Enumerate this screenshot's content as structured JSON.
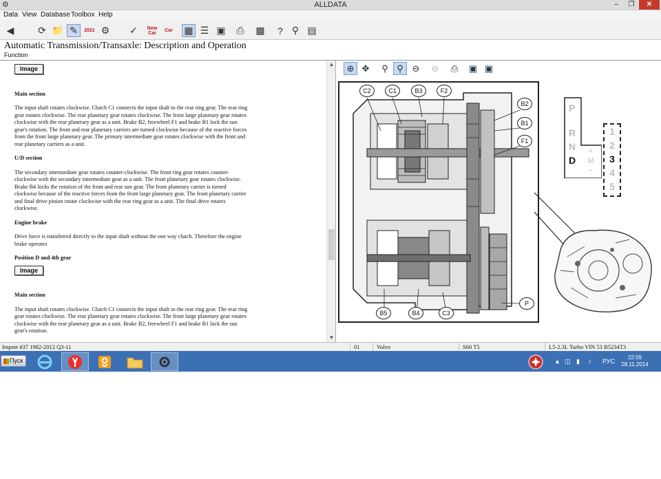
{
  "window": {
    "title": "ALLDATA"
  },
  "menu": [
    "Data",
    "View",
    "Database",
    "Toolbox",
    "Help"
  ],
  "toolbar": {
    "new_car_1": "New Car",
    "new_car_2": "Car",
    "badge_2021": "2021"
  },
  "header": {
    "title": "Automatic Transmission/Transaxle:  Description and Operation",
    "subtitle": "Function"
  },
  "content": {
    "image_button": "Image",
    "main_section_1": "Main section",
    "main_text_1": "The input shaft rotates clockwise. Clutch C1 connects the input shaft to the rear ring gear. The rear ring gear rotates clockwise. The rear planetary gear rotates clockwise. The front large planetary gear rotates clockwise with the rear planetary gear as a unit. Brake B2, freewheel F1 and brake B1 lock the sun gear's rotation. The front and rear planetary carriers are turned clockwise because of the reactive forces from the front large planetary gear. The primary intermediate gear rotates clockwise with the front and rear planetary carriers as a unit.",
    "ud_section": "U/D section",
    "ud_text": "The secondary intermediate gear rotates counter-clockwise. The front ring gear rotates counter-clockwise with the secondary intermediate gear as a unit. The front planetary gear rotates clockwise. Brake B4 locks the rotation of the front and rear sun gear. The front planetary carrier is turned clockwise because of the reactive forces from the front large planetary gear. The front planetary carrier and final drive pinion rotate clockwise with the rear ring gear as a unit. The final drive rotates clockwise.",
    "engine_brake": "Engine brake",
    "engine_brake_text": "Drive force is transferred directly to the input shaft without the one way clutch. Therefore the engine brake operates",
    "position_heading": "Position  D and 4th gear",
    "image_button_2": "Image",
    "main_section_2": "Main section",
    "main_text_2": "The input shaft rotates clockwise. Clutch C1 connects the input shaft to the rear ring gear. The rear ring gear rotates clockwise. The rear planetary gear rotates clockwise. The front large planetary gear rotates clockwise with the rear planetary gear as a unit. Brake B2, freewheel F1 and brake B1 lock the sun gear's rotation."
  },
  "diagram": {
    "callouts": [
      "C2",
      "C1",
      "B3",
      "F2",
      "B2",
      "B1",
      "F1",
      "P",
      "B5",
      "B4",
      "C3"
    ],
    "shifter_gates": [
      "P",
      "R",
      "N",
      "D"
    ],
    "shifter_options": [
      "+",
      "M",
      "−"
    ],
    "gears": [
      "1",
      "2",
      "3",
      "4",
      "5"
    ]
  },
  "status": {
    "import": "Import #37 1982-2012 Q3-11",
    "code": "01",
    "make": "Volvo",
    "model": "S60 T5",
    "engine": "L5-2.3L Turbo VIN 53 B5234T3"
  },
  "taskbar": {
    "start": "Пуск",
    "lang": "РУС",
    "time": "22:59",
    "date": "28.11.2014"
  }
}
